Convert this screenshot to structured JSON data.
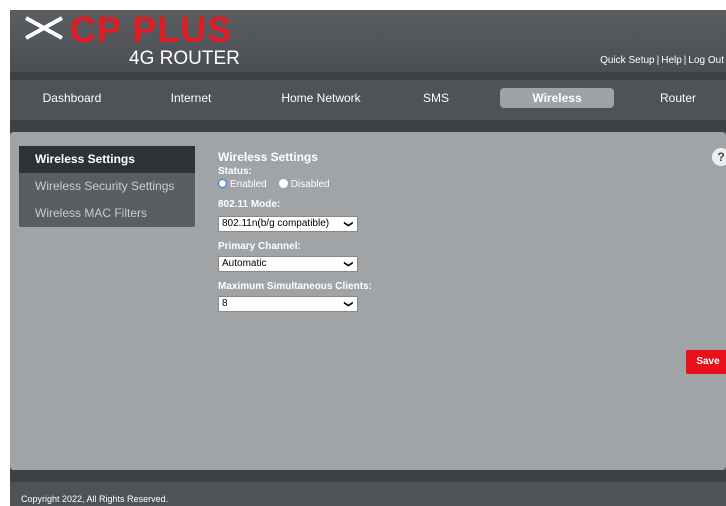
{
  "brand": {
    "name": "CP PLUS",
    "product": "4G ROUTER",
    "accent_color": "#e21a22"
  },
  "top_links": [
    "Quick Setup",
    "Help",
    "Log Out"
  ],
  "top_links_separator": "|",
  "nav": {
    "items": [
      "Dashboard",
      "Internet",
      "Home Network",
      "SMS",
      "Wireless",
      "Router"
    ],
    "active": "Wireless"
  },
  "sidebar": {
    "items": [
      "Wireless Settings",
      "Wireless Security Settings",
      "Wireless MAC Filters"
    ],
    "active": "Wireless Settings"
  },
  "form": {
    "title": "Wireless Settings",
    "status_label": "Status:",
    "status_options": [
      "Enabled",
      "Disabled"
    ],
    "status_selected": "Enabled",
    "mode_label": "802.11 Mode:",
    "mode_value": "802.11n(b/g compatible)",
    "channel_label": "Primary Channel:",
    "channel_value": "Automatic",
    "clients_label": "Maximum Simultaneous Clients:",
    "clients_value": "8"
  },
  "help_label": "?",
  "save_label": "Save",
  "save_color": "#e8101a",
  "footer": {
    "copyright": "Copyright 2022, All Rights Reserved."
  }
}
